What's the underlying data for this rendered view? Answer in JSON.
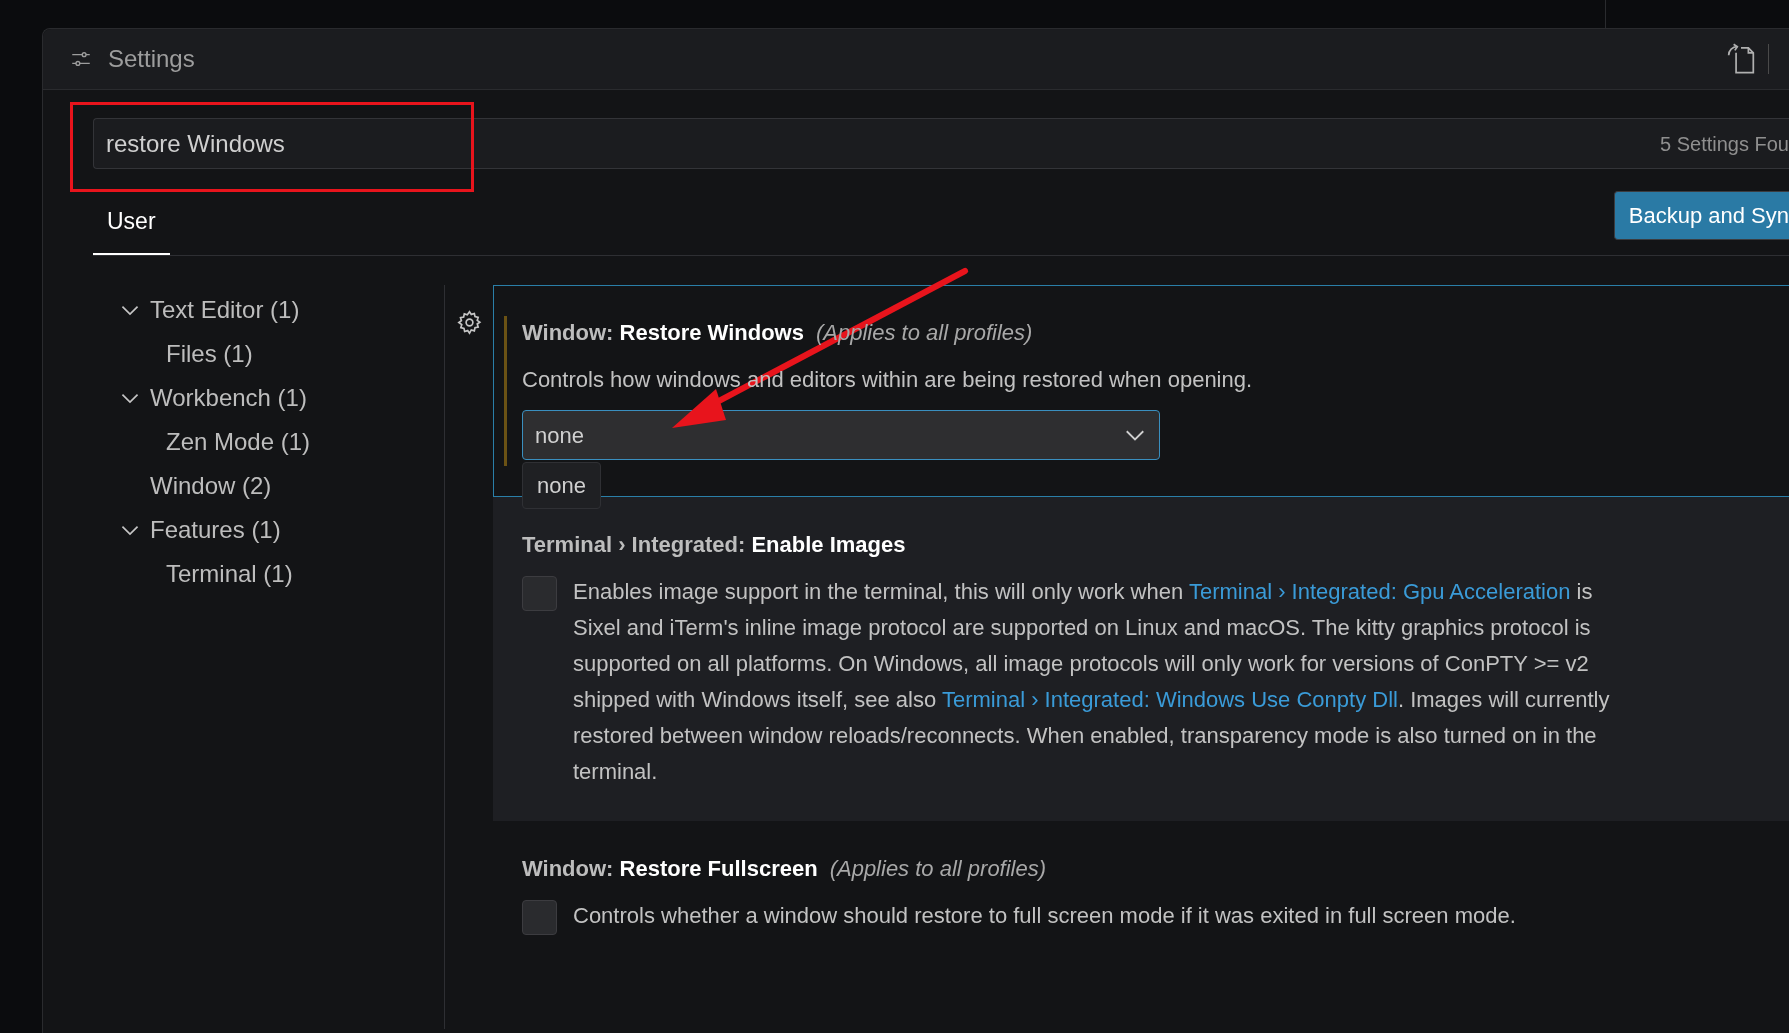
{
  "window": {
    "title": "Settings"
  },
  "search": {
    "value": "restore Windows",
    "result_count": "5 Settings Fou"
  },
  "tabs": [
    {
      "label": "User",
      "selected": true
    }
  ],
  "sync_button": {
    "label": "Backup and Syn"
  },
  "tree": [
    {
      "label": "Text Editor (1)",
      "expanded": true,
      "children": [
        {
          "label": "Files (1)"
        }
      ]
    },
    {
      "label": "Workbench (1)",
      "expanded": true,
      "children": [
        {
          "label": "Zen Mode (1)"
        }
      ]
    },
    {
      "label": "Window (2)"
    },
    {
      "label": "Features (1)",
      "expanded": true,
      "children": [
        {
          "label": "Terminal (1)"
        }
      ]
    }
  ],
  "settings": [
    {
      "kind": "dropdown",
      "category": "Window:",
      "name": "Restore Windows",
      "scope": "(Applies to all profiles)",
      "focused": true,
      "modified": true,
      "hovered": false,
      "description_lines": [
        [
          {
            "text": "Controls how windows and editors within are being restored when opening."
          }
        ]
      ],
      "value": "none",
      "hover_text": "none"
    },
    {
      "kind": "checkbox",
      "category": "Terminal › Integrated:",
      "name": "Enable Images",
      "focused": false,
      "modified": false,
      "hovered": true,
      "checked": false,
      "description_lines": [
        [
          {
            "text": "Enables image support in the terminal, this will only work when "
          },
          {
            "text": "Terminal › Integrated: Gpu Acceleration",
            "link": true
          },
          {
            "text": " is"
          }
        ],
        [
          {
            "text": "Sixel and iTerm's inline image protocol are supported on Linux and macOS. The kitty graphics protocol is"
          }
        ],
        [
          {
            "text": "supported on all platforms. On Windows, all image protocols will only work for versions of ConPTY >= v2"
          }
        ],
        [
          {
            "text": "shipped with Windows itself, see also "
          },
          {
            "text": "Terminal › Integrated: Windows Use Conpty Dll",
            "link": true
          },
          {
            "text": ". Images will currently"
          }
        ],
        [
          {
            "text": "restored between window reloads/reconnects. When enabled, transparency mode is also turned on in the"
          }
        ],
        [
          {
            "text": "terminal."
          }
        ]
      ]
    },
    {
      "kind": "checkbox",
      "category": "Window:",
      "name": "Restore Fullscreen",
      "scope": "(Applies to all profiles)",
      "focused": false,
      "modified": false,
      "hovered": false,
      "checked": false,
      "description_lines": [
        [
          {
            "text": "Controls whether a window should restore to full screen mode if it was exited in full screen mode."
          }
        ]
      ]
    }
  ]
}
